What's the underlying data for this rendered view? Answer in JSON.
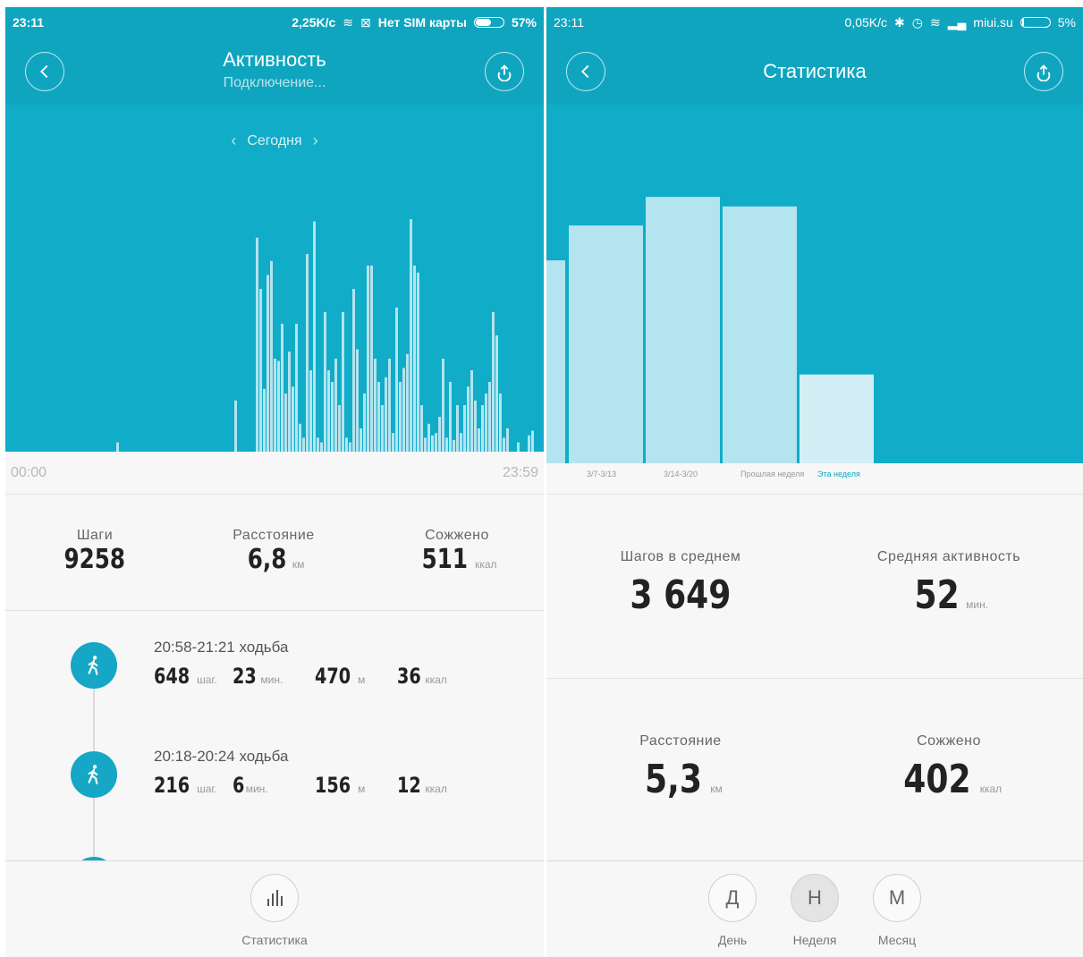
{
  "left": {
    "status": {
      "time": "23:11",
      "speed": "2,25K/с",
      "sim": "Нет SIM карты",
      "battery": "57%",
      "battery_level": 0.57
    },
    "header": {
      "title": "Активность",
      "subtitle": "Подключение..."
    },
    "date_nav": {
      "label": "Сегодня"
    },
    "chart_data": {
      "type": "bar",
      "title": "",
      "x_start_label": "00:00",
      "x_end_label": "23:59",
      "x_unit": "minute-of-day bins",
      "values": [
        0,
        0,
        0,
        0,
        0,
        0,
        0,
        0,
        0,
        0,
        0,
        0,
        0,
        0,
        0,
        0,
        0,
        0,
        0,
        0,
        0,
        0,
        0,
        0,
        0,
        0,
        0,
        0,
        4,
        0,
        0,
        0,
        0,
        0,
        0,
        0,
        0,
        0,
        0,
        0,
        0,
        0,
        0,
        0,
        0,
        0,
        0,
        0,
        0,
        0,
        0,
        0,
        0,
        0,
        0,
        0,
        0,
        0,
        0,
        0,
        0,
        22,
        0,
        0,
        0,
        0,
        0,
        92,
        70,
        27,
        76,
        82,
        40,
        39,
        55,
        25,
        43,
        28,
        55,
        12,
        6,
        85,
        35,
        99,
        6,
        4,
        60,
        35,
        30,
        40,
        20,
        60,
        6,
        4,
        70,
        44,
        10,
        25,
        80,
        80,
        40,
        30,
        20,
        32,
        40,
        8,
        62,
        30,
        36,
        42,
        100,
        80,
        77,
        20,
        6,
        12,
        7,
        8,
        15,
        40,
        6,
        30,
        5,
        20,
        8,
        20,
        28,
        35,
        22,
        10,
        20,
        25,
        30,
        60,
        50,
        25,
        6,
        10,
        0,
        0,
        4,
        0,
        0,
        7,
        9
      ]
    },
    "summary": {
      "steps_label": "Шаги",
      "steps_value": "9258",
      "distance_label": "Расстояние",
      "distance_value": "6,8",
      "distance_unit": "км",
      "burned_label": "Сожжено",
      "burned_value": "511",
      "burned_unit": "ккал"
    },
    "activities": [
      {
        "time": "20:58-21:21 ходьба",
        "steps": "648",
        "steps_unit": "шаг.",
        "minutes": "23",
        "minutes_unit": "мин.",
        "meters": "470",
        "meters_unit": "м",
        "kcal": "36",
        "kcal_unit": "ккал"
      },
      {
        "time": "20:18-20:24 ходьба",
        "steps": "216",
        "steps_unit": "шаг.",
        "minutes": "6",
        "minutes_unit": "мин.",
        "meters": "156",
        "meters_unit": "м",
        "kcal": "12",
        "kcal_unit": "ккал"
      }
    ],
    "bottom": {
      "stats_label": "Статистика"
    }
  },
  "right": {
    "status": {
      "time": "23:11",
      "speed": "0,05K/с",
      "carrier": "miui.su",
      "battery": "5%",
      "battery_level": 0.05
    },
    "header": {
      "title": "Статистика"
    },
    "chart_data": {
      "type": "bar",
      "categories": [
        "",
        "3/7-3/13",
        "3/14-3/20",
        "Прошлая неделя",
        "Эта неделя"
      ],
      "values": [
        3200,
        3750,
        4200,
        4050,
        1400
      ],
      "highlight_index": 4,
      "ylim": [
        0,
        5500
      ]
    },
    "summary": {
      "avg_steps_label": "Шагов в среднем",
      "avg_steps_value": "3 649",
      "avg_activity_label": "Средняя активность",
      "avg_activity_value": "52",
      "avg_activity_unit": "мин.",
      "distance_label": "Расстояние",
      "distance_value": "5,3",
      "distance_unit": "км",
      "burned_label": "Сожжено",
      "burned_value": "402",
      "burned_unit": "ккал"
    },
    "periods": [
      {
        "letter": "Д",
        "label": "День",
        "active": false
      },
      {
        "letter": "Н",
        "label": "Неделя",
        "active": true
      },
      {
        "letter": "М",
        "label": "Месяц",
        "active": false
      }
    ]
  },
  "colors": {
    "header": "#10a5bf",
    "chart_bg": "#10acc8",
    "bar_light": "#b4e4ef",
    "bar_highlight": "#d3eff5",
    "accent": "#14a5c2"
  }
}
